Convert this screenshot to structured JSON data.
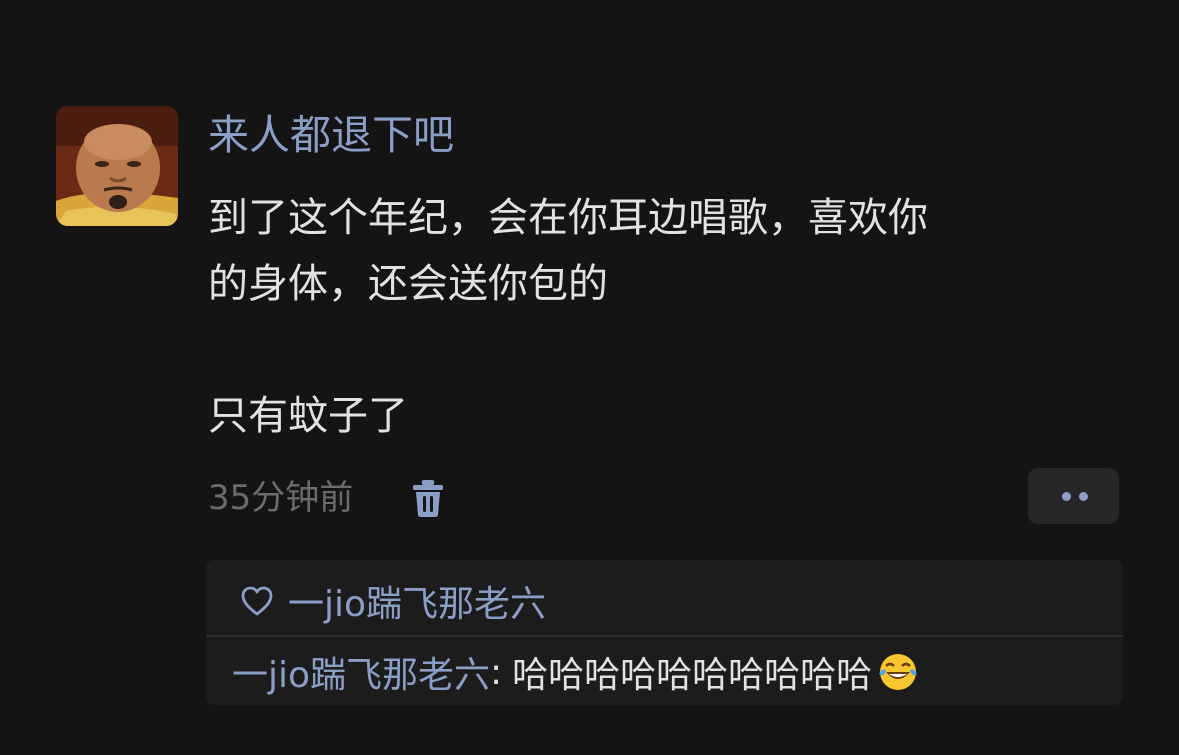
{
  "post": {
    "username": "来人都退下吧",
    "text_lines": [
      "到了这个年纪，会在你耳边唱歌，喜欢你",
      "的身体，还会送你包的",
      "只有蚊子了"
    ],
    "timestamp": "35分钟前",
    "avatar_icon": "man-face-avatar",
    "delete_icon": "trash-icon",
    "more_icon": "more-dots-icon"
  },
  "comments": {
    "like_icon": "heart-outline-icon",
    "liked_by": "一jio踹飞那老六",
    "replies": [
      {
        "name": "一jio踹飞那老六",
        "separator": ":",
        "text": "哈哈哈哈哈哈哈哈哈哈",
        "emoji": "tears-of-joy-emoji"
      }
    ]
  },
  "colors": {
    "background": "#141414",
    "name_blue": "#8a9ec6",
    "text": "#e2e2e2",
    "muted": "#6b6b6b",
    "comment_bg": "#1c1c1c"
  }
}
